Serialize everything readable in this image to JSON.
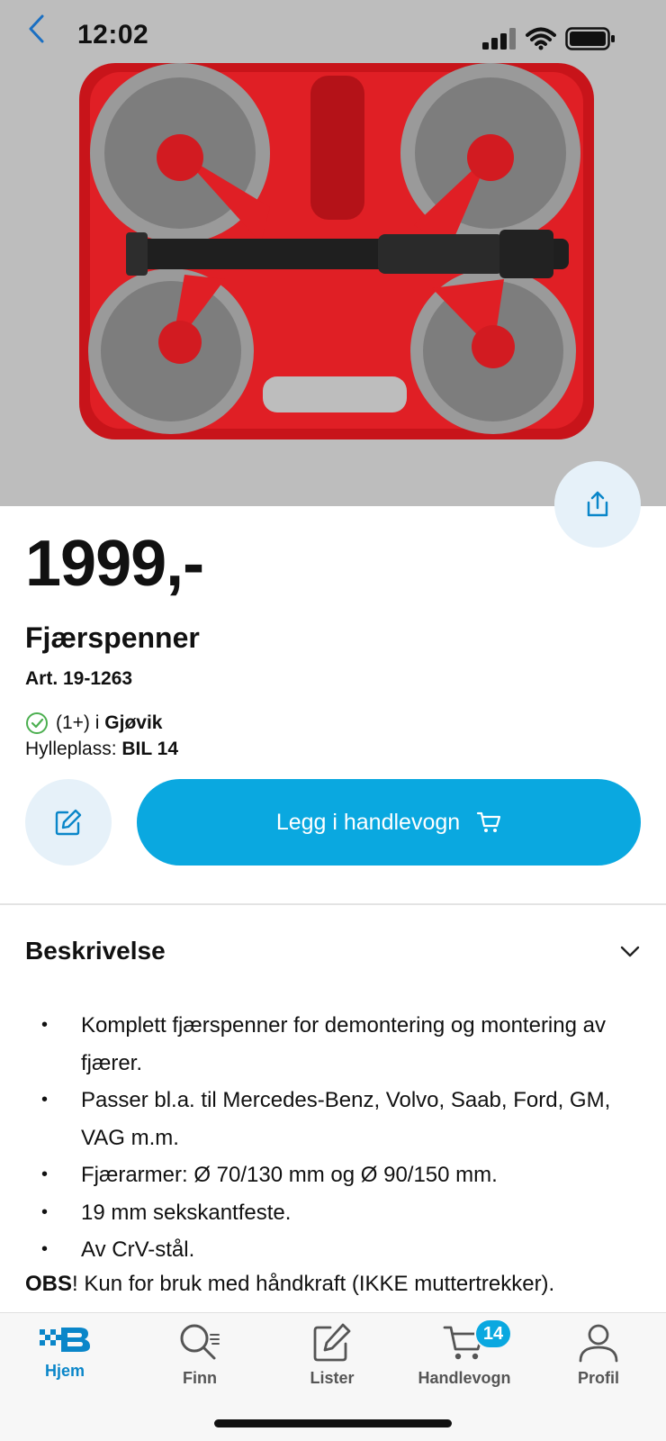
{
  "status_bar": {
    "time": "12:02"
  },
  "product": {
    "price": "1999,-",
    "title": "Fjærspenner",
    "article": "Art. 19-1263",
    "stock_count": "(1+) i",
    "stock_store": "Gjøvik",
    "shelf_label": "Hylleplass:",
    "shelf_value": "BIL 14"
  },
  "actions": {
    "add_to_cart_label": "Legg i handlevogn"
  },
  "description": {
    "title": "Beskrivelse",
    "bullets": [
      "Komplett fjærspenner for demontering og montering av fjærer.",
      "Passer bl.a. til Mercedes-Benz, Volvo, Saab, Ford, GM, VAG m.m.",
      "Fjærarmer: Ø 70/130 mm og Ø 90/150 mm.",
      "19 mm sekskantfeste.",
      "Av CrV-stål."
    ],
    "obs_bold": "OBS",
    "obs_text": "! Kun for bruk med håndkraft (IKKE muttertrekker)."
  },
  "tabbar": {
    "tabs": [
      {
        "label": "Hjem",
        "icon": "brand-logo-icon",
        "active": true
      },
      {
        "label": "Finn",
        "icon": "search-icon",
        "active": false
      },
      {
        "label": "Lister",
        "icon": "edit-list-icon",
        "active": false
      },
      {
        "label": "Handlevogn",
        "icon": "cart-icon",
        "active": false
      },
      {
        "label": "Profil",
        "icon": "profile-icon",
        "active": false
      }
    ],
    "cart_badge": "14"
  },
  "colors": {
    "accent": "#0aa8e0",
    "accent_dark": "#0a86c9",
    "button_soft": "#e6f1f9",
    "case_red": "#d8171d",
    "check_green": "#4caf50"
  }
}
